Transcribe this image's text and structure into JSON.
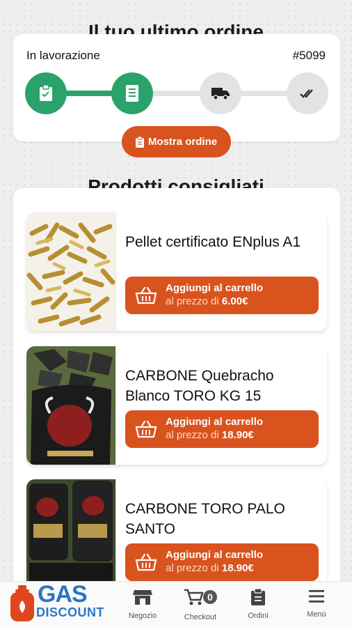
{
  "last_order": {
    "title": "Il tuo ultimo ordine",
    "status": "In lavorazione",
    "number": "#5099",
    "steps": [
      {
        "icon": "clipboard-icon",
        "done": true
      },
      {
        "icon": "receipt-icon",
        "done": true
      },
      {
        "icon": "truck-icon",
        "done": false
      },
      {
        "icon": "double-check-icon",
        "done": false
      }
    ],
    "show_button": "Mostra ordine"
  },
  "recommended": {
    "title": "Prodotti consigliati",
    "products": [
      {
        "name": "Pellet certificato ENplus A1",
        "add_label": "Aggiungi al carrello",
        "price_prefix": "al prezzo di",
        "price": "6.00€"
      },
      {
        "name": "CARBONE Quebracho Blanco TORO KG 15",
        "add_label": "Aggiungi al carrello",
        "price_prefix": "al prezzo di",
        "price": "18.90€"
      },
      {
        "name": "CARBONE TORO PALO SANTO",
        "add_label": "Aggiungi al carrello",
        "price_prefix": "al prezzo di",
        "price": "18.90€"
      }
    ]
  },
  "nav": {
    "logo_top": "GAS",
    "logo_bottom": "DISCOUNT",
    "items": [
      {
        "label": "Negozio",
        "icon": "store-icon"
      },
      {
        "label": "Checkout",
        "icon": "cart-icon",
        "badge": "0"
      },
      {
        "label": "Ordini",
        "icon": "orders-icon"
      },
      {
        "label": "Menù",
        "icon": "hamburger-icon"
      }
    ]
  },
  "colors": {
    "accent": "#d9531e",
    "success": "#2aa36b",
    "brand": "#2b76c4",
    "inactive": "#e3e3e3"
  }
}
